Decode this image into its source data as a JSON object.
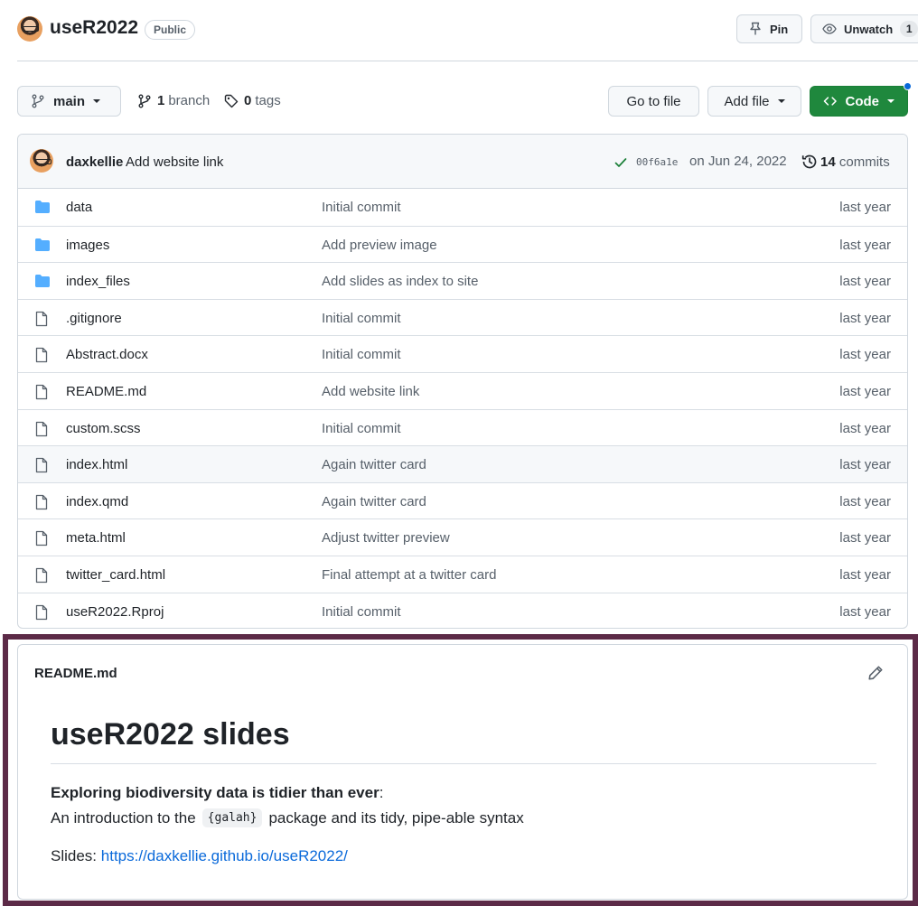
{
  "repo": {
    "name": "useR2022",
    "visibility": "Public",
    "pin_label": "Pin",
    "unwatch_label": "Unwatch",
    "watch_count": "1"
  },
  "toolbar": {
    "branch": "main",
    "branch_count": "1",
    "branch_word": "branch",
    "tag_count": "0",
    "tag_word": "tags",
    "goto_label": "Go to file",
    "addfile_label": "Add file",
    "code_label": "Code"
  },
  "latest_commit": {
    "author": "daxkellie",
    "message": "Add website link",
    "sha": "00f6a1e",
    "date": "on Jun 24, 2022",
    "commit_count": "14",
    "commit_word": "commits"
  },
  "files": [
    {
      "type": "folder",
      "name": "data",
      "commit": "Initial commit",
      "age": "last year"
    },
    {
      "type": "folder",
      "name": "images",
      "commit": "Add preview image",
      "age": "last year"
    },
    {
      "type": "folder",
      "name": "index_files",
      "commit": "Add slides as index to site",
      "age": "last year"
    },
    {
      "type": "file",
      "name": ".gitignore",
      "commit": "Initial commit",
      "age": "last year"
    },
    {
      "type": "file",
      "name": "Abstract.docx",
      "commit": "Initial commit",
      "age": "last year"
    },
    {
      "type": "file",
      "name": "README.md",
      "commit": "Add website link",
      "age": "last year"
    },
    {
      "type": "file",
      "name": "custom.scss",
      "commit": "Initial commit",
      "age": "last year"
    },
    {
      "type": "file",
      "name": "index.html",
      "commit": "Again twitter card",
      "age": "last year"
    },
    {
      "type": "file",
      "name": "index.qmd",
      "commit": "Again twitter card",
      "age": "last year"
    },
    {
      "type": "file",
      "name": "meta.html",
      "commit": "Adjust twitter preview",
      "age": "last year"
    },
    {
      "type": "file",
      "name": "twitter_card.html",
      "commit": "Final attempt at a twitter card",
      "age": "last year"
    },
    {
      "type": "file",
      "name": "useR2022.Rproj",
      "commit": "Initial commit",
      "age": "last year"
    }
  ],
  "readme": {
    "filename": "README.md",
    "heading": "useR2022 slides",
    "bold_line": "Exploring biodiversity data is tidier than ever",
    "bold_colon": ":",
    "intro_before": "An introduction to the",
    "inline_code": "{galah}",
    "intro_after": "package and its tidy, pipe-able syntax",
    "slides_label": "Slides:",
    "slides_url": "https://daxkellie.github.io/useR2022/"
  },
  "colors": {
    "primary_green": "#1f883d",
    "link_blue": "#0969da",
    "folder_blue": "#54aeff",
    "highlight_frame": "#5c2a47"
  },
  "icons": {
    "folder": "folder-icon",
    "file": "file-icon",
    "branch": "git-branch-icon",
    "tag": "tag-icon",
    "pin": "pin-icon",
    "eye": "eye-icon",
    "code": "code-icon",
    "check": "check-icon",
    "history": "history-icon",
    "pencil": "pencil-icon"
  }
}
